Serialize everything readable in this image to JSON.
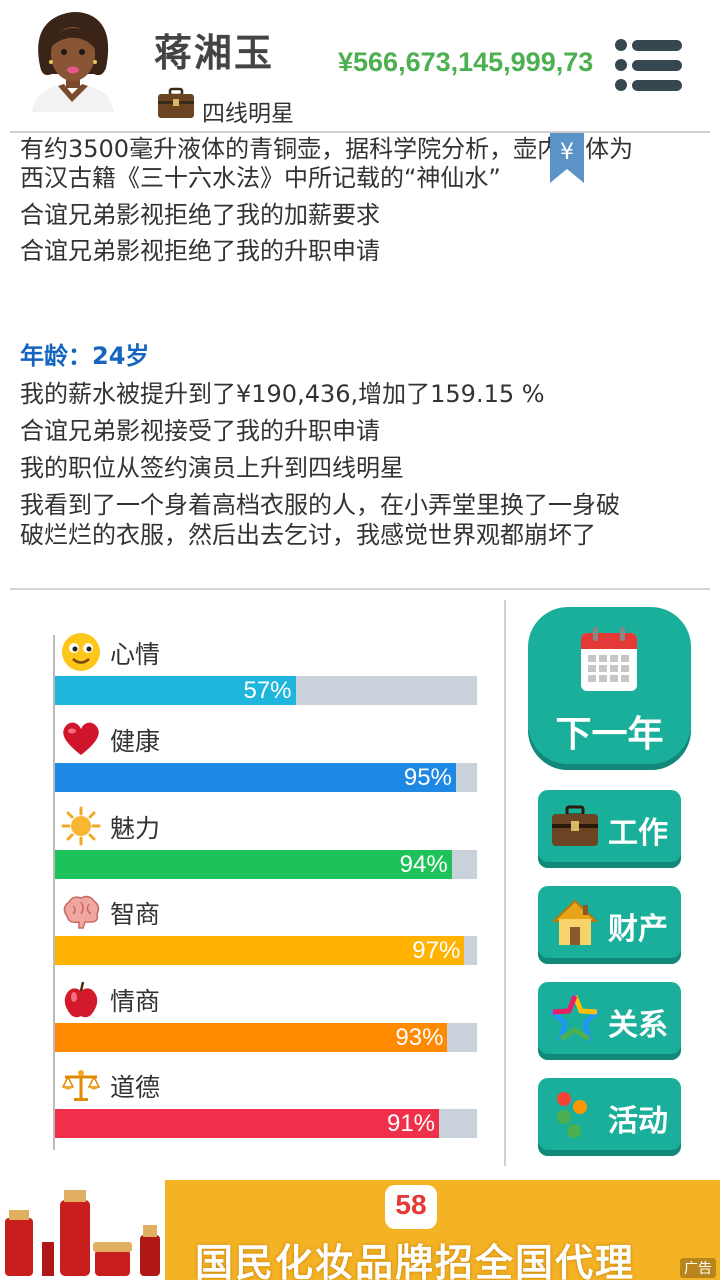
{
  "header": {
    "player_name": "蒋湘玉",
    "job_title": "四线明星",
    "money": "¥566,673,145,999,73"
  },
  "log": {
    "lines": [
      "有约3500毫升液体的青铜壶，据科学院分析，壶内液体为",
      "西汉古籍《三十六水法》中所记载的“神仙水”",
      "合谊兄弟影视拒绝了我的加薪要求",
      "合谊兄弟影视拒绝了我的升职申请",
      "年龄：24岁",
      "我的薪水被提升到了¥190,436,增加了159.15 %",
      "合谊兄弟影视接受了我的升职申请",
      "我的职位从签约演员上升到四线明星",
      "我看到了一个身着高档衣服的人，在小弄堂里换了一身破",
      "破烂烂的衣服，然后出去乞讨，我感觉世界观都崩坏了"
    ]
  },
  "stats": [
    {
      "label": "心情",
      "value": 57,
      "display": "57%",
      "color": "#1fb5dc",
      "icon": "smiley-face-icon"
    },
    {
      "label": "健康",
      "value": 95,
      "display": "95%",
      "color": "#1e88e5",
      "icon": "heart-icon"
    },
    {
      "label": "魅力",
      "value": 94,
      "display": "94%",
      "color": "#1ec25a",
      "icon": "sun-icon"
    },
    {
      "label": "智商",
      "value": 97,
      "display": "97%",
      "color": "#ffb300",
      "icon": "brain-icon"
    },
    {
      "label": "情商",
      "value": 93,
      "display": "93%",
      "color": "#ff8a00",
      "icon": "apple-icon"
    },
    {
      "label": "道德",
      "value": 91,
      "display": "91%",
      "color": "#f0304a",
      "icon": "scales-icon"
    }
  ],
  "actions": {
    "next_year": "下一年",
    "work": "工作",
    "assets": "财产",
    "relations": "关系",
    "activities": "活动"
  },
  "ad": {
    "logo": "58",
    "text": "国民化妆品牌招全国代理",
    "tag": "广告"
  },
  "colors": {
    "money": "#4caf50",
    "age_heading": "#1565c0",
    "button": "#1aaf9b",
    "ad_background": "#f4b225"
  }
}
